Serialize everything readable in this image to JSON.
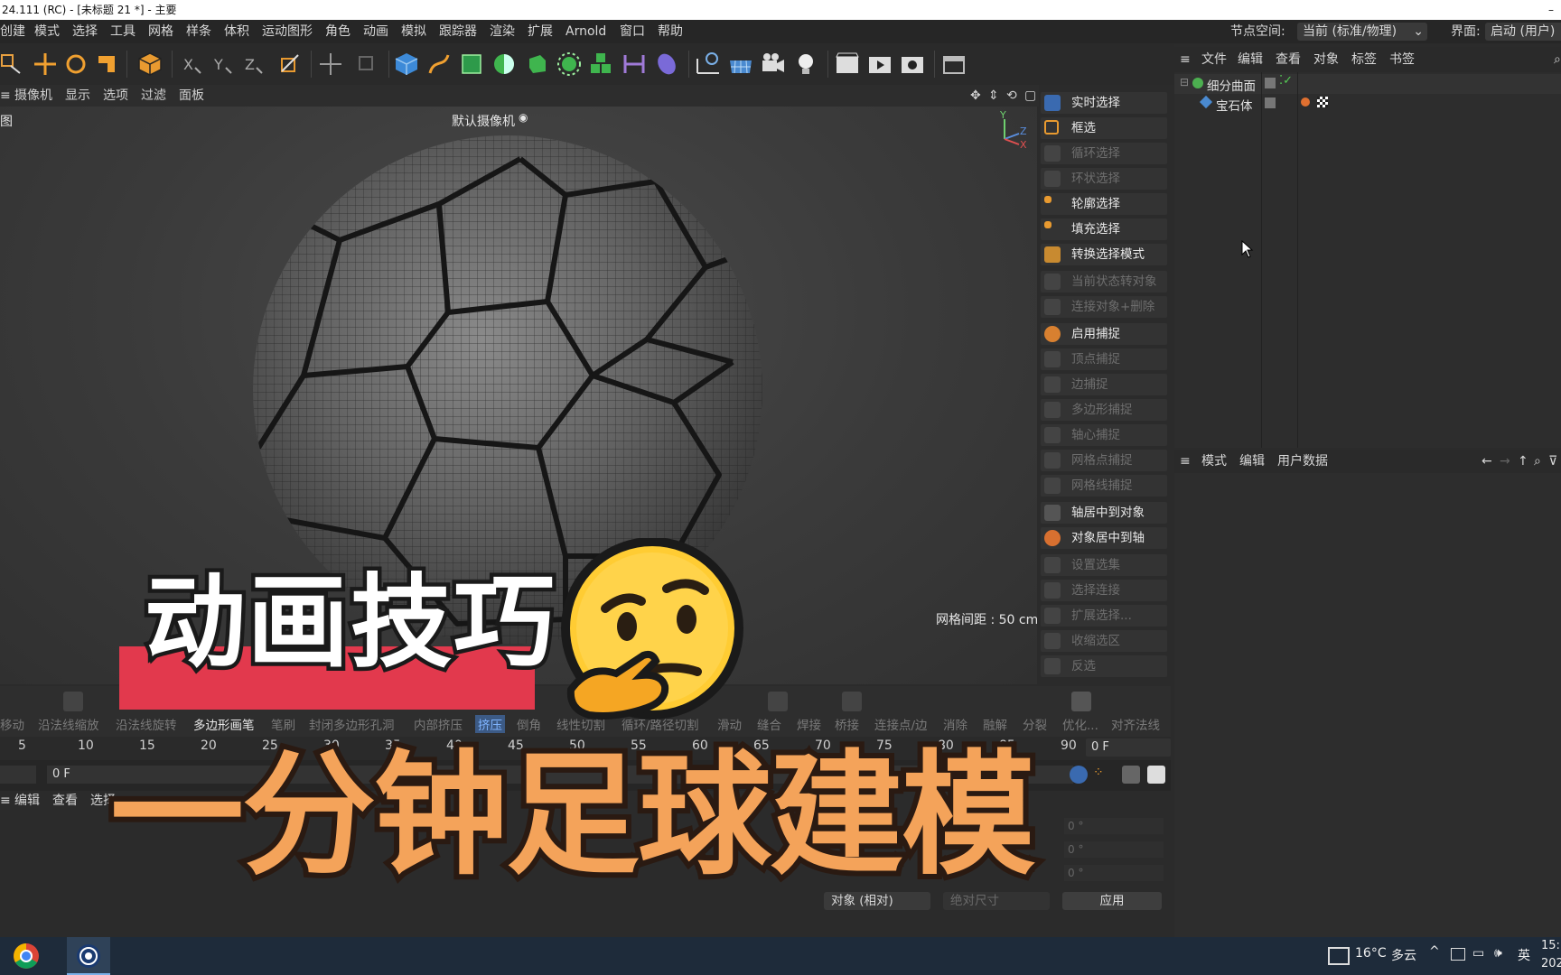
{
  "window": {
    "title": "24.111 (RC) - [未标题 21 *] - 主要",
    "minimize": "–"
  },
  "menubar": {
    "items": [
      "创建",
      "模式",
      "选择",
      "工具",
      "网格",
      "样条",
      "体积",
      "运动图形",
      "角色",
      "动画",
      "模拟",
      "跟踪器",
      "渲染",
      "扩展",
      "Arnold",
      "窗口",
      "帮助"
    ],
    "node_space_label": "节点空间:",
    "node_space_value": "当前 (标准/物理)",
    "interface_label": "界面:",
    "interface_value": "启动 (用户)"
  },
  "viewport": {
    "menu": [
      "摄像机",
      "显示",
      "选项",
      "过滤",
      "面板"
    ],
    "camera_label": "默认摄像机",
    "grid_spacing": "网格间距 : 50 cm",
    "axis_y": "Y",
    "axis_z": "Z",
    "axis_x": "X",
    "corner_label": "图"
  },
  "commands": [
    {
      "label": "实时选择",
      "enabled": true
    },
    {
      "label": "框选",
      "enabled": true
    },
    {
      "label": "循环选择",
      "enabled": false
    },
    {
      "label": "环状选择",
      "enabled": false
    },
    {
      "label": "轮廓选择",
      "enabled": true
    },
    {
      "label": "填充选择",
      "enabled": true
    },
    {
      "label": "转换选择模式",
      "enabled": true
    },
    {
      "label": "当前状态转对象",
      "enabled": false
    },
    {
      "label": "连接对象+删除",
      "enabled": false
    },
    {
      "label": "启用捕捉",
      "enabled": true
    },
    {
      "label": "顶点捕捉",
      "enabled": false
    },
    {
      "label": "边捕捉",
      "enabled": false
    },
    {
      "label": "多边形捕捉",
      "enabled": false
    },
    {
      "label": "轴心捕捉",
      "enabled": false
    },
    {
      "label": "网格点捕捉",
      "enabled": false
    },
    {
      "label": "网格线捕捉",
      "enabled": false
    },
    {
      "label": "轴居中到对象",
      "enabled": true
    },
    {
      "label": "对象居中到轴",
      "enabled": true
    },
    {
      "label": "设置选集",
      "enabled": false
    },
    {
      "label": "选择连接",
      "enabled": false
    },
    {
      "label": "扩展选择...",
      "enabled": false
    },
    {
      "label": "收缩选区",
      "enabled": false
    },
    {
      "label": "反选",
      "enabled": false
    }
  ],
  "object_manager": {
    "menu": [
      "文件",
      "编辑",
      "查看",
      "对象",
      "标签",
      "书签"
    ],
    "objects": [
      "细分曲面",
      "宝石体"
    ]
  },
  "attribute_manager": {
    "menu": [
      "模式",
      "编辑",
      "用户数据"
    ]
  },
  "tool_row": {
    "items": [
      {
        "label": "移动",
        "state": "off"
      },
      {
        "label": "沿法线缩放",
        "state": "off"
      },
      {
        "label": "沿法线旋转",
        "state": "off"
      },
      {
        "label": "多边形画笔",
        "state": "on"
      },
      {
        "label": "笔刷",
        "state": "off"
      },
      {
        "label": "封闭多边形孔洞",
        "state": "off"
      },
      {
        "label": "内部挤压",
        "state": "off"
      },
      {
        "label": "挤压",
        "state": "sel"
      },
      {
        "label": "倒角",
        "state": "off"
      },
      {
        "label": "线性切割",
        "state": "off"
      },
      {
        "label": "循环/路径切割",
        "state": "off"
      },
      {
        "label": "滑动",
        "state": "off"
      },
      {
        "label": "缝合",
        "state": "off"
      },
      {
        "label": "焊接",
        "state": "off"
      },
      {
        "label": "桥接",
        "state": "off"
      },
      {
        "label": "连接点/边",
        "state": "off"
      },
      {
        "label": "消除",
        "state": "off"
      },
      {
        "label": "融解",
        "state": "off"
      },
      {
        "label": "分裂",
        "state": "off"
      },
      {
        "label": "优化...",
        "state": "off"
      },
      {
        "label": "对齐法线",
        "state": "off"
      }
    ]
  },
  "timeline": {
    "ticks": [
      "5",
      "10",
      "15",
      "20",
      "25",
      "30",
      "35",
      "40",
      "45",
      "50",
      "55",
      "60",
      "65",
      "70",
      "75",
      "80",
      "85",
      "90"
    ],
    "end_frame": "0 F",
    "current_frame": "0 F"
  },
  "bottom_panel": {
    "menu": [
      "编辑",
      "查看",
      "选择"
    ],
    "coord_mode": "对象 (相对)",
    "size_mode": "绝对尺寸",
    "apply_button": "应用",
    "rot_values": [
      "0 °",
      "0 °",
      "0 °"
    ]
  },
  "taskbar": {
    "temperature": "16°C",
    "weather": "多云",
    "ime": "英",
    "time": "15:",
    "date": "202"
  },
  "overlay": {
    "subtitle": "动画技巧",
    "headline": "一分钟足球建模"
  }
}
